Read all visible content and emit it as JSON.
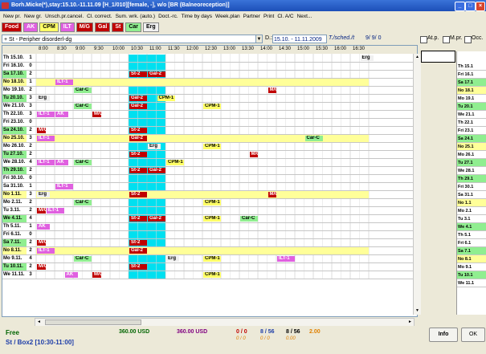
{
  "title": "Borh.Micke(*),stay:15.10.-11.11.09 [H_1/010][female, -], w/o  [BR (Balneoreception)]",
  "menu": [
    "New pr.",
    "New gr.",
    "Unsch.pr.cancel.",
    "Cl. correct.",
    "Sum. wrk. (auto.)",
    "Doct.-rc.",
    "Time by days",
    "Week.plan",
    "Partner",
    "Print",
    "Cl. A/C",
    "Next..."
  ],
  "tags": [
    {
      "label": "Food",
      "bg": "#c00000",
      "fg": "#ffffff"
    },
    {
      "label": "AK",
      "bg": "#e060e0",
      "fg": "#ffffff"
    },
    {
      "label": "CPM",
      "bg": "#ffff66",
      "fg": "#000000"
    },
    {
      "label": "ILT",
      "bg": "#e060e0",
      "fg": "#ffffff"
    },
    {
      "label": "M/G",
      "bg": "#c00000",
      "fg": "#ffffff"
    },
    {
      "label": "Gal",
      "bg": "#c00000",
      "fg": "#ffffff"
    },
    {
      "label": "St",
      "bg": "#c00000",
      "fg": "#ffffff"
    },
    {
      "label": "Car",
      "bg": "#90ee90",
      "fg": "#000000"
    },
    {
      "label": "Erg",
      "bg": "#f0f0f0",
      "fg": "#000000"
    }
  ],
  "patient_select": "+ St - Peripher disorderl-dg",
  "date_label": "D.:",
  "date_range": "15.10. - 11.11.2009",
  "sched_label": "T./sched./t",
  "sched_value": "9/  9/  0",
  "checkboxes": [
    "At.p.",
    "M.pr.",
    "Occ."
  ],
  "times": [
    "8:00",
    "8:30",
    "9:00",
    "9:30",
    "10:00",
    "10:30",
    "11:00",
    "11:30",
    "12:00",
    "12:30",
    "13:00",
    "13:30",
    "14:00",
    "14:30",
    "15:00",
    "15:30",
    "16:00",
    "16:30"
  ],
  "rows": [
    {
      "day": "Th",
      "date": "15.10.",
      "cnt": "1",
      "bg": "#ffffff",
      "items": [
        {
          "text": "Erg",
          "col": 35,
          "span": 1.5,
          "bg": "#f0f0f0",
          "fg": "#000000"
        }
      ]
    },
    {
      "day": "Fri",
      "date": "16.10.",
      "cnt": "0",
      "bg": "#ffffff",
      "items": []
    },
    {
      "day": "Sa",
      "date": "17.10.",
      "cnt": "2",
      "bg": "#90ee90",
      "items": [
        {
          "text": "St-2",
          "col": 10,
          "span": 2,
          "bg": "#c00000",
          "fg": "#ffffff"
        },
        {
          "text": "Gal-2",
          "col": 12,
          "span": 2,
          "bg": "#c00000",
          "fg": "#ffffff"
        }
      ]
    },
    {
      "day": "No",
      "date": "18.10.",
      "cnt": "1",
      "bg": "#ffff99",
      "items": [
        {
          "text": "ILT-1",
          "col": 2,
          "span": 2,
          "bg": "#e060e0",
          "fg": "#ffffff"
        }
      ]
    },
    {
      "day": "Mo",
      "date": "19.10.",
      "cnt": "2",
      "bg": "#ffffff",
      "items": [
        {
          "text": "Car-C",
          "col": 4,
          "span": 2,
          "bg": "#90ee90",
          "fg": "#000000"
        },
        {
          "text": "M/G1",
          "col": 25,
          "span": 1,
          "bg": "#c00000",
          "fg": "#ffffff"
        }
      ]
    },
    {
      "day": "Tu",
      "date": "20.10.",
      "cnt": "3",
      "bg": "#90ee90",
      "items": [
        {
          "text": "Erg",
          "col": 0,
          "span": 1.5,
          "bg": "#f0f0f0",
          "fg": "#000000"
        },
        {
          "text": "Gal-2",
          "col": 10,
          "span": 2,
          "bg": "#c00000",
          "fg": "#ffffff"
        },
        {
          "text": "CPM-1",
          "col": 13,
          "span": 2,
          "bg": "#ffff66",
          "fg": "#000000"
        }
      ]
    },
    {
      "day": "We",
      "date": "21.10.",
      "cnt": "3",
      "bg": "#ffffff",
      "items": [
        {
          "text": "Car-C",
          "col": 4,
          "span": 2,
          "bg": "#90ee90",
          "fg": "#000000"
        },
        {
          "text": "Gal-2",
          "col": 10,
          "span": 2,
          "bg": "#c00000",
          "fg": "#ffffff"
        },
        {
          "text": "CPM-1",
          "col": 18,
          "span": 2,
          "bg": "#ffff66",
          "fg": "#000000"
        }
      ]
    },
    {
      "day": "Th",
      "date": "22.10.",
      "cnt": "3",
      "bg": "#ffffff",
      "items": [
        {
          "text": "ILT-1",
          "col": 0,
          "span": 2,
          "bg": "#e060e0",
          "fg": "#ffffff"
        },
        {
          "text": "AK",
          "col": 2,
          "span": 1.5,
          "bg": "#e060e0",
          "fg": "#ffffff"
        },
        {
          "text": "M/G1",
          "col": 6,
          "span": 1,
          "bg": "#c00000",
          "fg": "#ffffff"
        }
      ]
    },
    {
      "day": "Fri",
      "date": "23.10.",
      "cnt": "0",
      "bg": "#ffffff",
      "items": []
    },
    {
      "day": "Sa",
      "date": "24.10.",
      "cnt": "2",
      "bg": "#90ee90",
      "items": [
        {
          "text": "M/G1",
          "col": 0,
          "span": 1,
          "bg": "#c00000",
          "fg": "#ffffff"
        },
        {
          "text": "St-2",
          "col": 10,
          "span": 2,
          "bg": "#c00000",
          "fg": "#ffffff"
        }
      ]
    },
    {
      "day": "No",
      "date": "25.10.",
      "cnt": "3",
      "bg": "#ffff99",
      "items": [
        {
          "text": "ILT-1",
          "col": 0,
          "span": 2,
          "bg": "#e060e0",
          "fg": "#ffffff"
        },
        {
          "text": "Gal-2",
          "col": 10,
          "span": 2,
          "bg": "#c00000",
          "fg": "#ffffff"
        },
        {
          "text": "Car-C",
          "col": 29,
          "span": 2,
          "bg": "#90ee90",
          "fg": "#000000"
        }
      ]
    },
    {
      "day": "Mo",
      "date": "26.10.",
      "cnt": "2",
      "bg": "#ffffff",
      "items": [
        {
          "text": "Erg",
          "col": 12,
          "span": 1.5,
          "bg": "#f0f0f0",
          "fg": "#000000"
        },
        {
          "text": "CPM-1",
          "col": 18,
          "span": 2,
          "bg": "#ffff66",
          "fg": "#000000"
        }
      ]
    },
    {
      "day": "Tu",
      "date": "27.10.",
      "cnt": "2",
      "bg": "#90ee90",
      "items": [
        {
          "text": "St-2",
          "col": 10,
          "span": 2,
          "bg": "#c00000",
          "fg": "#ffffff"
        },
        {
          "text": "M/G1",
          "col": 23,
          "span": 1,
          "bg": "#c00000",
          "fg": "#ffffff"
        }
      ]
    },
    {
      "day": "We",
      "date": "28.10.",
      "cnt": "4",
      "bg": "#ffffff",
      "items": [
        {
          "text": "ILT-1",
          "col": 0,
          "span": 2,
          "bg": "#e060e0",
          "fg": "#ffffff"
        },
        {
          "text": "AK",
          "col": 2,
          "span": 1.5,
          "bg": "#e060e0",
          "fg": "#ffffff"
        },
        {
          "text": "Car-C",
          "col": 4,
          "span": 2,
          "bg": "#90ee90",
          "fg": "#000000"
        },
        {
          "text": "CPM-1",
          "col": 14,
          "span": 2,
          "bg": "#ffff66",
          "fg": "#000000"
        }
      ]
    },
    {
      "day": "Th",
      "date": "29.10.",
      "cnt": "2",
      "bg": "#90ee90",
      "items": [
        {
          "text": "St-2",
          "col": 10,
          "span": 2,
          "bg": "#c00000",
          "fg": "#ffffff"
        },
        {
          "text": "Gal-2",
          "col": 12,
          "span": 2,
          "bg": "#c00000",
          "fg": "#ffffff"
        }
      ]
    },
    {
      "day": "Fri",
      "date": "30.10.",
      "cnt": "0",
      "bg": "#ffffff",
      "items": []
    },
    {
      "day": "Sa",
      "date": "31.10.",
      "cnt": "1",
      "bg": "#ffffff",
      "items": [
        {
          "text": "ILT-1",
          "col": 2,
          "span": 2,
          "bg": "#e060e0",
          "fg": "#ffffff"
        }
      ]
    },
    {
      "day": "No",
      "date": "1.11.",
      "cnt": "3",
      "bg": "#ffff99",
      "items": [
        {
          "text": "Erg",
          "col": 0,
          "span": 1.5,
          "bg": "#f0f0f0",
          "fg": "#000000"
        },
        {
          "text": "St-2",
          "col": 10,
          "span": 2,
          "bg": "#c00000",
          "fg": "#ffffff"
        },
        {
          "text": "M/G1",
          "col": 25,
          "span": 1,
          "bg": "#c00000",
          "fg": "#ffffff"
        }
      ]
    },
    {
      "day": "Mo",
      "date": "2.11.",
      "cnt": "2",
      "bg": "#ffffff",
      "items": [
        {
          "text": "Car-C",
          "col": 4,
          "span": 2,
          "bg": "#90ee90",
          "fg": "#000000"
        },
        {
          "text": "CPM-1",
          "col": 18,
          "span": 2,
          "bg": "#ffff66",
          "fg": "#000000"
        }
      ]
    },
    {
      "day": "Tu",
      "date": "3.11.",
      "cnt": "2",
      "bg": "#ffffff",
      "items": [
        {
          "text": "M/G1",
          "col": 0,
          "span": 1,
          "bg": "#c00000",
          "fg": "#ffffff"
        },
        {
          "text": "ILT-1",
          "col": 1,
          "span": 2,
          "bg": "#e060e0",
          "fg": "#ffffff"
        }
      ]
    },
    {
      "day": "We",
      "date": "4.11.",
      "cnt": "4",
      "bg": "#90ee90",
      "items": [
        {
          "text": "St-2",
          "col": 10,
          "span": 2,
          "bg": "#c00000",
          "fg": "#ffffff"
        },
        {
          "text": "Gal-2",
          "col": 12,
          "span": 2,
          "bg": "#c00000",
          "fg": "#ffffff"
        },
        {
          "text": "CPM-1",
          "col": 18,
          "span": 2,
          "bg": "#ffff66",
          "fg": "#000000"
        },
        {
          "text": "Car-C",
          "col": 22,
          "span": 2,
          "bg": "#90ee90",
          "fg": "#000000"
        }
      ]
    },
    {
      "day": "Th",
      "date": "5.11.",
      "cnt": "1",
      "bg": "#ffffff",
      "items": [
        {
          "text": "AK",
          "col": 0,
          "span": 1.5,
          "bg": "#e060e0",
          "fg": "#ffffff"
        }
      ]
    },
    {
      "day": "Fri",
      "date": "6.11.",
      "cnt": "0",
      "bg": "#ffffff",
      "items": []
    },
    {
      "day": "Sa",
      "date": "7.11.",
      "cnt": "2",
      "bg": "#90ee90",
      "items": [
        {
          "text": "M/G1",
          "col": 0,
          "span": 1,
          "bg": "#c00000",
          "fg": "#ffffff"
        },
        {
          "text": "St-2",
          "col": 10,
          "span": 2,
          "bg": "#c00000",
          "fg": "#ffffff"
        }
      ]
    },
    {
      "day": "No",
      "date": "8.11.",
      "cnt": "2",
      "bg": "#ffff99",
      "items": [
        {
          "text": "ILT-1",
          "col": 0,
          "span": 2,
          "bg": "#e060e0",
          "fg": "#ffffff"
        },
        {
          "text": "Gal-2",
          "col": 10,
          "span": 2,
          "bg": "#c00000",
          "fg": "#ffffff"
        }
      ]
    },
    {
      "day": "Mo",
      "date": "9.11.",
      "cnt": "4",
      "bg": "#ffffff",
      "items": [
        {
          "text": "Car-C",
          "col": 4,
          "span": 2,
          "bg": "#90ee90",
          "fg": "#000000"
        },
        {
          "text": "Erg",
          "col": 14,
          "span": 1.5,
          "bg": "#f0f0f0",
          "fg": "#000000"
        },
        {
          "text": "CPM-1",
          "col": 18,
          "span": 2,
          "bg": "#ffff66",
          "fg": "#000000"
        },
        {
          "text": "ILT-1",
          "col": 26,
          "span": 2,
          "bg": "#e060e0",
          "fg": "#ffffff"
        }
      ]
    },
    {
      "day": "Tu",
      "date": "10.11.",
      "cnt": "2",
      "bg": "#90ee90",
      "items": [
        {
          "text": "M/G1",
          "col": 0,
          "span": 1,
          "bg": "#c00000",
          "fg": "#ffffff"
        },
        {
          "text": "St-2",
          "col": 10,
          "span": 2,
          "bg": "#c00000",
          "fg": "#ffffff"
        }
      ]
    },
    {
      "day": "We",
      "date": "11.11.",
      "cnt": "3",
      "bg": "#ffffff",
      "items": [
        {
          "text": "AK",
          "col": 3,
          "span": 1.5,
          "bg": "#e060e0",
          "fg": "#ffffff"
        },
        {
          "text": "M/G1",
          "col": 6,
          "span": 1,
          "bg": "#c00000",
          "fg": "#ffffff"
        },
        {
          "text": "CPM-1",
          "col": 18,
          "span": 2,
          "bg": "#ffff66",
          "fg": "#000000"
        }
      ]
    }
  ],
  "right_rows": [
    {
      "label": "Th 15.1",
      "bg": "#ffffff"
    },
    {
      "label": "Fri 16.1",
      "bg": "#ffffff"
    },
    {
      "label": "Sa 17.1",
      "bg": "#90ee90"
    },
    {
      "label": "No 18.1",
      "bg": "#ffff99"
    },
    {
      "label": "Mo 19.1",
      "bg": "#ffffff"
    },
    {
      "label": "Tu 20.1",
      "bg": "#90ee90"
    },
    {
      "label": "We 21.1",
      "bg": "#ffffff"
    },
    {
      "label": "Th 22.1",
      "bg": "#ffffff"
    },
    {
      "label": "Fri 23.1",
      "bg": "#ffffff"
    },
    {
      "label": "Sa 24.1",
      "bg": "#90ee90"
    },
    {
      "label": "No 25.1",
      "bg": "#ffff99"
    },
    {
      "label": "Mo 26.1",
      "bg": "#ffffff"
    },
    {
      "label": "Tu 27.1",
      "bg": "#90ee90"
    },
    {
      "label": "We 28.1",
      "bg": "#ffffff"
    },
    {
      "label": "Th 29.1",
      "bg": "#90ee90"
    },
    {
      "label": "Fri 30.1",
      "bg": "#ffffff"
    },
    {
      "label": "Sa 31.1",
      "bg": "#ffffff"
    },
    {
      "label": "No 1.1",
      "bg": "#ffff99"
    },
    {
      "label": "Mo 2.1",
      "bg": "#ffffff"
    },
    {
      "label": "Tu 3.1",
      "bg": "#ffffff"
    },
    {
      "label": "We 4.1",
      "bg": "#90ee90"
    },
    {
      "label": "Th 5.1",
      "bg": "#ffffff"
    },
    {
      "label": "Fri 6.1",
      "bg": "#ffffff"
    },
    {
      "label": "Sa 7.1",
      "bg": "#90ee90"
    },
    {
      "label": "No 8.1",
      "bg": "#ffff99"
    },
    {
      "label": "Mo 9.1",
      "bg": "#ffffff"
    },
    {
      "label": "Tu 10.1",
      "bg": "#90ee90"
    },
    {
      "label": "We 11.1",
      "bg": "#ffffff"
    }
  ],
  "status": {
    "free": "Free",
    "slot": "St / Box2 [10:30-11:00]",
    "amount1": "360.00 USD",
    "amount2": "360.00 USD",
    "ratio1": "0 / 0",
    "ratio2": "8 / 56",
    "ratio3": "8 / 56",
    "value": "2.00",
    "sub1": "0 / 0",
    "sub2": "0 / 0",
    "sub3": "0.00",
    "info": "Info",
    "ok": "OK"
  },
  "colors": {
    "highlight": "#00e0f0",
    "accent": "#1c4fb8"
  }
}
